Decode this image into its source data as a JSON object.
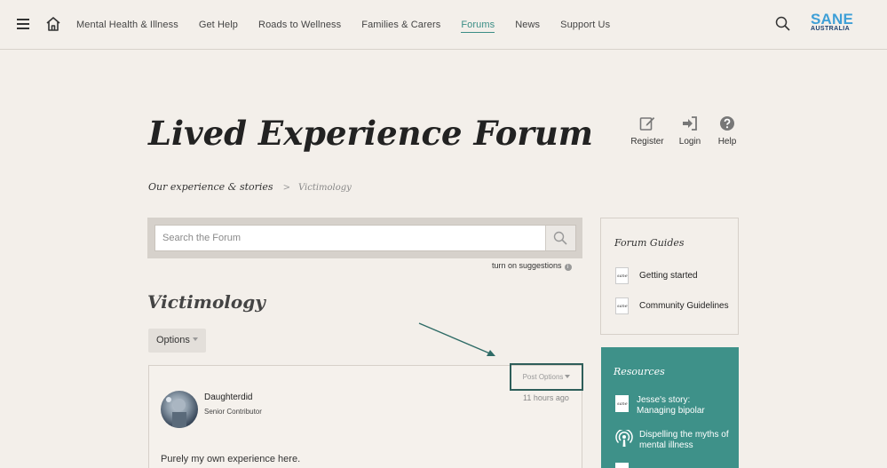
{
  "nav": {
    "items": [
      "Mental Health & Illness",
      "Get Help",
      "Roads to Wellness",
      "Families & Carers",
      "Forums",
      "News",
      "Support Us"
    ],
    "active": "Forums"
  },
  "logo": {
    "line1": "SANE",
    "line2": "AUSTRALIA"
  },
  "page": {
    "title": "Lived Experience Forum",
    "actions": {
      "register": "Register",
      "login": "Login",
      "help": "Help"
    },
    "breadcrumb": {
      "parent": "Our experience & stories",
      "separator": ">",
      "current": "Victimology"
    }
  },
  "search": {
    "placeholder": "Search the Forum",
    "suggestions_label": "turn on suggestions",
    "info": "i"
  },
  "board": {
    "title": "Victimology",
    "options_label": "Options"
  },
  "post": {
    "options_label": "Post Options",
    "author": "Daughterdid",
    "rank": "Senior Contributor",
    "time": "11 hours ago",
    "body": "Purely my own experience here."
  },
  "sidebar": {
    "guides": {
      "title": "Forum Guides",
      "doc_icon_text": "sane",
      "items": [
        "Getting started",
        "Community Guidelines"
      ]
    },
    "resources": {
      "title": "Resources",
      "items": [
        {
          "line1": "Jesse's story:",
          "line2": "Managing bipolar"
        },
        {
          "line1": "Dispelling the myths of",
          "line2": "mental illness"
        }
      ]
    }
  },
  "colors": {
    "accent": "#3a8d85",
    "resources_bg": "#3e9189",
    "page_bg": "#f3efea",
    "logo_blue": "#3e9fd7",
    "logo_navy": "#1c3f6e"
  }
}
